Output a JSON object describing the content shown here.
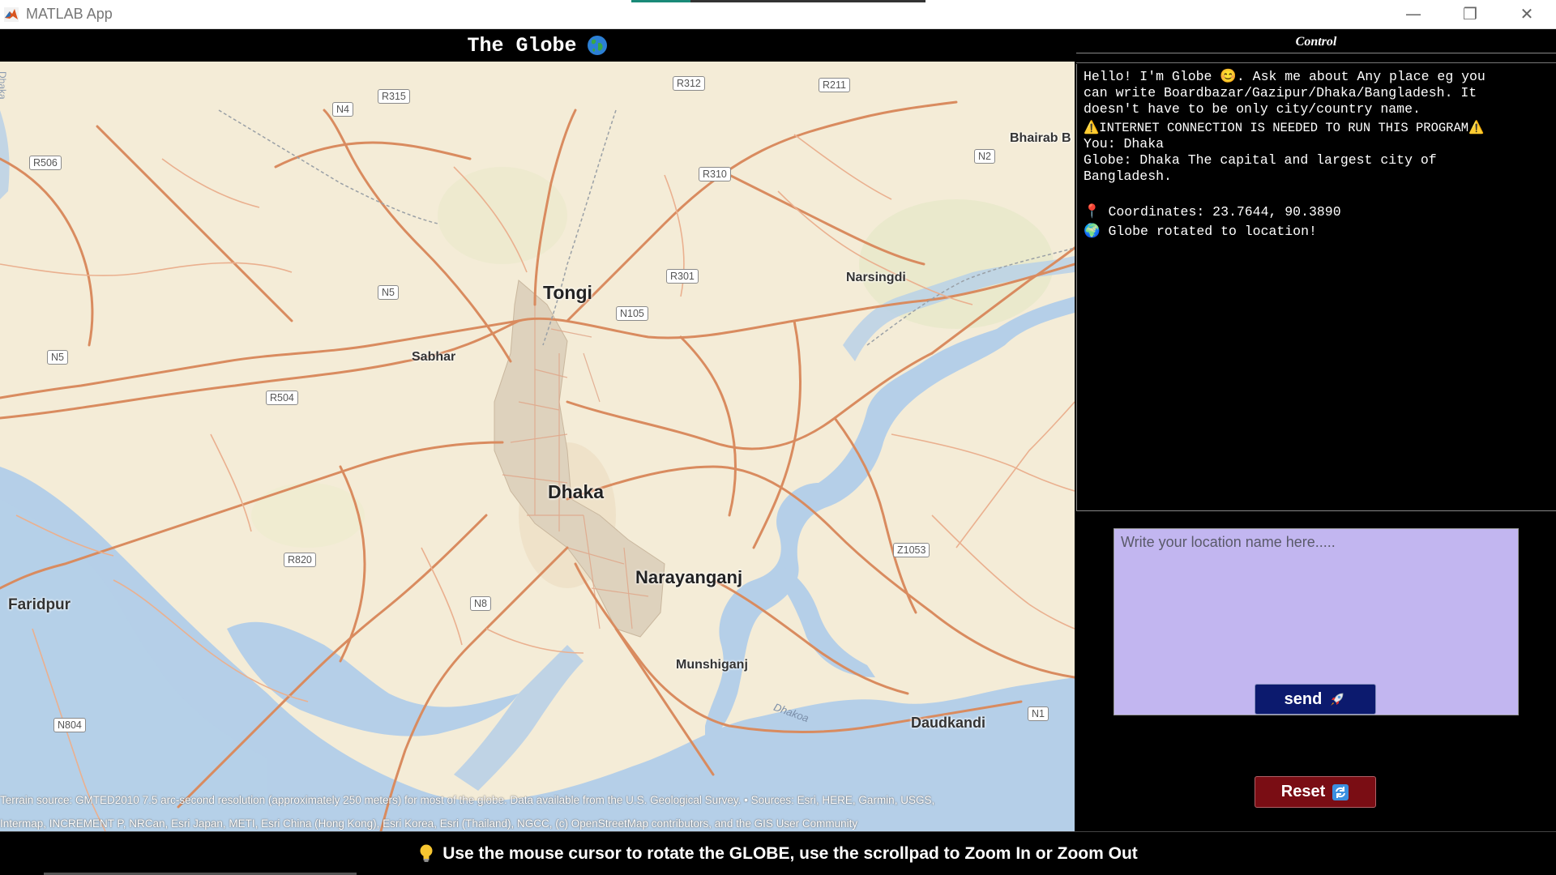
{
  "window": {
    "title": "MATLAB App",
    "minimize_symbol": "—",
    "maximize_symbol": "❐",
    "close_symbol": "✕"
  },
  "globe": {
    "title": "The Globe",
    "icon": "earth-icon"
  },
  "map": {
    "labels": {
      "dhaka_vertical": "Dhaka",
      "r506": "R506",
      "n4": "N4",
      "r315": "R315",
      "r312": "R312",
      "r211": "R211",
      "bhairab": "Bhairab B",
      "n2": "N2",
      "r310": "R310",
      "r301": "R301",
      "narsingdi": "Narsingdi",
      "tongi": "Tongi",
      "n5a": "N5",
      "n105": "N105",
      "n5b": "N5",
      "sabhar": "Sabhar",
      "r504": "R504",
      "dhaka": "Dhaka",
      "z1053": "Z1053",
      "r820": "R820",
      "narayanganj": "Narayanganj",
      "faridpur": "Faridpur",
      "n8": "N8",
      "munshiganj": "Munshiganj",
      "dhakoa": "Dhakoa",
      "n1": "N1",
      "daudkandi": "Daudkandi",
      "n804": "N804"
    },
    "attribution_line1": "Terrain source: GMTED2010 7.5 arc-second resolution (approximately 250 meters) for most of the globe. Data available from the U.S. Geological Survey. • Sources: Esri, HERE, Garmin, USGS,",
    "attribution_line2": "Intermap, INCREMENT P, NRCan, Esri Japan, METI, Esri China (Hong Kong), Esri Korea, Esri (Thailand), NGCC, (c) OpenStreetMap contributors, and the GIS User Community"
  },
  "control": {
    "title": "Control",
    "chat": {
      "greeting": "Hello! I'm Globe 😊. Ask me about Any place eg you\ncan write Boardbazar/Gazipur/Dhaka/Bangladesh. It\ndoesn't have to be only city/country name.",
      "warning": "⚠️INTERNET CONNECTION IS NEEDED TO RUN THIS PROGRAM⚠️",
      "user_msg": "You: Dhaka",
      "globe_msg": "Globe: Dhaka The capital and largest city of\nBangladesh.",
      "coordinates": "📍 Coordinates: 23.7644, 90.3890",
      "rotated": "🌍 Globe rotated to location!"
    },
    "input": {
      "value": "",
      "placeholder": "Write your location name here....."
    },
    "send_label": "send",
    "send_icon": "rocket-icon",
    "reset_label": "Reset",
    "reset_icon": "refresh-icon"
  },
  "footer": {
    "text": "Use the mouse cursor to rotate the GLOBE, use the scrollpad to Zoom In or Zoom Out",
    "icon": "lightbulb-icon"
  },
  "colors": {
    "map_land": "#f4ecd7",
    "map_water": "#b5cfe8",
    "map_road": "#d98b5f",
    "input_bg": "#c2b6f0",
    "send_bg": "#0c1a6e",
    "reset_bg": "#7a0d14"
  }
}
